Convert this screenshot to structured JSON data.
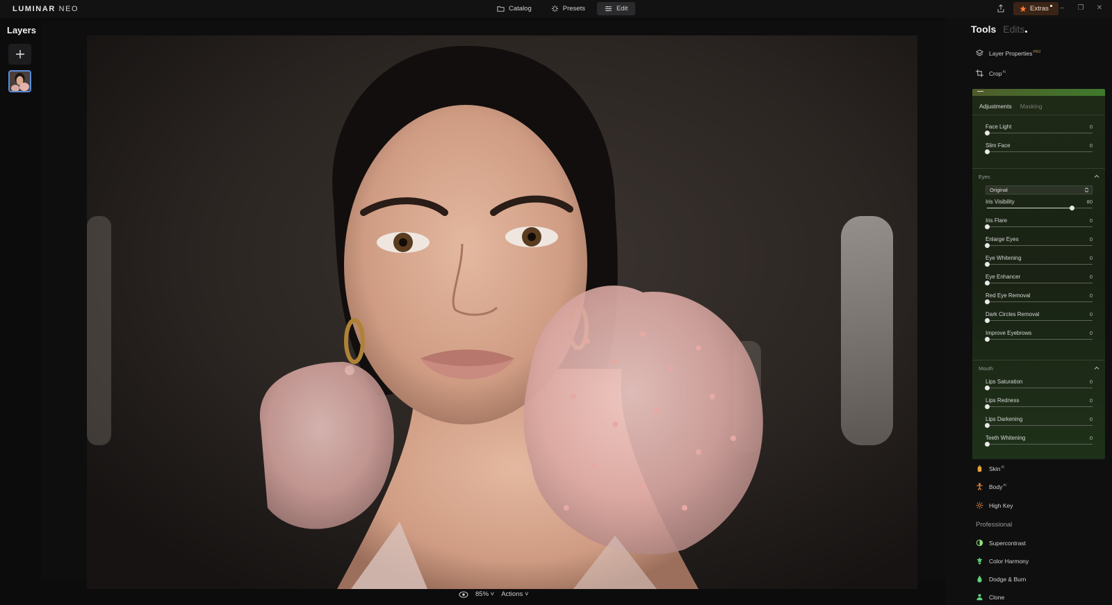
{
  "app": {
    "logo_main": "LUMINAR",
    "logo_sub": "NEO"
  },
  "modes": [
    {
      "label": "Catalog",
      "icon": "folder-icon"
    },
    {
      "label": "Presets",
      "icon": "presets-icon"
    },
    {
      "label": "Edit",
      "icon": "sliders-icon",
      "active": true
    }
  ],
  "extras": {
    "label": "Extras"
  },
  "layers": {
    "title": "Layers"
  },
  "panel": {
    "tabs": {
      "tools": "Tools",
      "edits": "Edits"
    },
    "tools_top": [
      {
        "label": "Layer Properties",
        "sup": "PRO"
      },
      {
        "label": "Crop",
        "sup": "AI"
      }
    ],
    "sub_tabs": {
      "adjustments": "Adjustments",
      "masking": "Masking"
    },
    "face_sliders": [
      {
        "label": "Face Light",
        "value": "0",
        "pct": 0
      },
      {
        "label": "Slim Face",
        "value": "0",
        "pct": 0
      }
    ],
    "eyes": {
      "title": "Eyes",
      "dropdown": "Original",
      "sliders": [
        {
          "label": "Iris Visibility",
          "value": "80",
          "pct": 80
        },
        {
          "label": "Iris Flare",
          "value": "0",
          "pct": 0
        },
        {
          "label": "Enlarge Eyes",
          "value": "0",
          "pct": 0
        },
        {
          "label": "Eye Whitening",
          "value": "0",
          "pct": 0
        },
        {
          "label": "Eye Enhancer",
          "value": "0",
          "pct": 0
        },
        {
          "label": "Red Eye Removal",
          "value": "0",
          "pct": 0
        },
        {
          "label": "Dark Circles Removal",
          "value": "0",
          "pct": 0
        },
        {
          "label": "Improve Eyebrows",
          "value": "0",
          "pct": 0
        }
      ]
    },
    "mouth": {
      "title": "Mouth",
      "sliders": [
        {
          "label": "Lips Saturation",
          "value": "0",
          "pct": 0
        },
        {
          "label": "Lips Redness",
          "value": "0",
          "pct": 0
        },
        {
          "label": "Lips Darkening",
          "value": "0",
          "pct": 0
        },
        {
          "label": "Teeth Whitening",
          "value": "0",
          "pct": 0
        }
      ]
    },
    "tools_more": [
      {
        "label": "Skin",
        "sup": "AI",
        "color": "#e8a23a"
      },
      {
        "label": "Body",
        "sup": "AI",
        "color": "#e8893a"
      },
      {
        "label": "High Key",
        "sup": "",
        "color": "#e8893a"
      }
    ],
    "professional": {
      "title": "Professional",
      "tools": [
        {
          "label": "Supercontrast",
          "color": "#8fe07a"
        },
        {
          "label": "Color Harmony",
          "color": "#5fd27a"
        },
        {
          "label": "Dodge & Burn",
          "color": "#5fd27a"
        },
        {
          "label": "Clone",
          "color": "#5fd27a"
        }
      ]
    }
  },
  "bottom": {
    "zoom": "85%",
    "actions": "Actions"
  }
}
